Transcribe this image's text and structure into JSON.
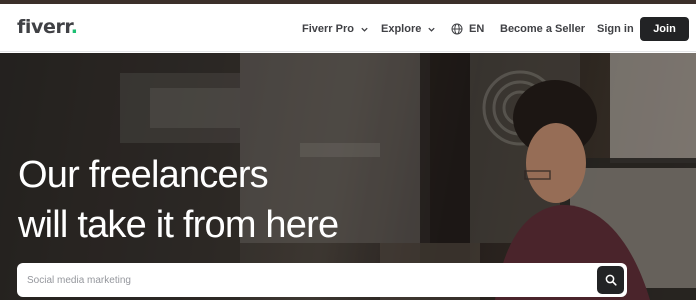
{
  "header": {
    "logo_text": "fiverr",
    "logo_dot": ".",
    "nav": {
      "fiverr_pro": "Fiverr Pro",
      "explore": "Explore",
      "language": "EN",
      "become_seller": "Become a Seller",
      "sign_in": "Sign in",
      "join": "Join"
    }
  },
  "hero": {
    "title_line1": "Our freelancers",
    "title_line2": "will take it from here"
  },
  "search": {
    "placeholder": "Social media marketing"
  },
  "colors": {
    "brand_green": "#1dbf73",
    "text_dark": "#404145",
    "button_dark": "#222325"
  }
}
